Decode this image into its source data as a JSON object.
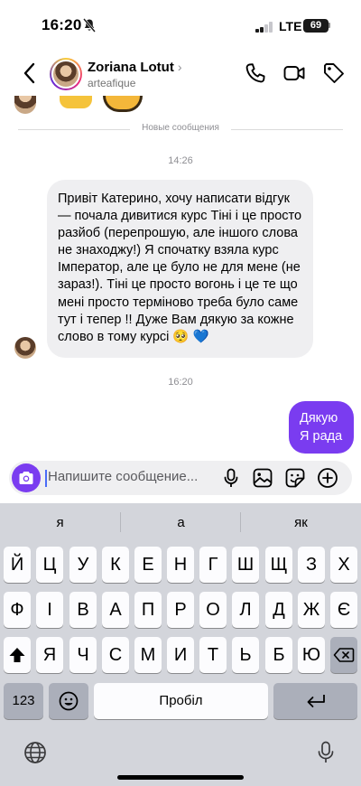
{
  "status_bar": {
    "time": "16:20",
    "network": "LTE",
    "battery": "69"
  },
  "header": {
    "name": "Zoriana Lotut",
    "name_chevron": "›",
    "handle": "arteafique",
    "icons": [
      "back-icon",
      "phone-icon",
      "video-camera-icon",
      "tag-icon"
    ]
  },
  "chat": {
    "divider_label": "Новые сообщения",
    "time_1": "14:26",
    "incoming_message": "Привіт Катерино, хочу написати відгук — почала дивитися курс Тіні і це просто разйоб (перепрошую, але іншого слова не знаходжу!) Я спочатку взяла курс Імператор, але це було не для мене (не зараз!). Тіні це просто вогонь і це те що мені просто терміново треба було саме тут і тепер !! Дуже Вам дякую за кожне слово в тому курсі 🥺 💙",
    "time_2": "16:20",
    "outgoing_message": [
      "Дякую",
      "Я рада"
    ]
  },
  "composer": {
    "placeholder": "Напишите сообщение...",
    "icons": [
      "camera-icon",
      "microphone-icon",
      "gallery-icon",
      "sticker-icon",
      "plus-icon"
    ]
  },
  "keyboard": {
    "suggestions": [
      "я",
      "а",
      "як"
    ],
    "row1": [
      "Й",
      "Ц",
      "У",
      "К",
      "Е",
      "Н",
      "Г",
      "Ш",
      "Щ",
      "З",
      "Х"
    ],
    "row2": [
      "Ф",
      "І",
      "В",
      "А",
      "П",
      "Р",
      "О",
      "Л",
      "Д",
      "Ж",
      "Є"
    ],
    "row3": [
      "Я",
      "Ч",
      "С",
      "М",
      "И",
      "Т",
      "Ь",
      "Б",
      "Ю"
    ],
    "numbers_key": "123",
    "space_key": "Пробіл",
    "icons": [
      "shift-icon",
      "backspace-icon",
      "emoji-icon",
      "return-icon",
      "globe-icon",
      "dictation-icon"
    ]
  },
  "colors": {
    "accent": "#7a3cf0",
    "incoming_bubble": "#efeff1",
    "keyboard_bg": "#d3d5db"
  }
}
